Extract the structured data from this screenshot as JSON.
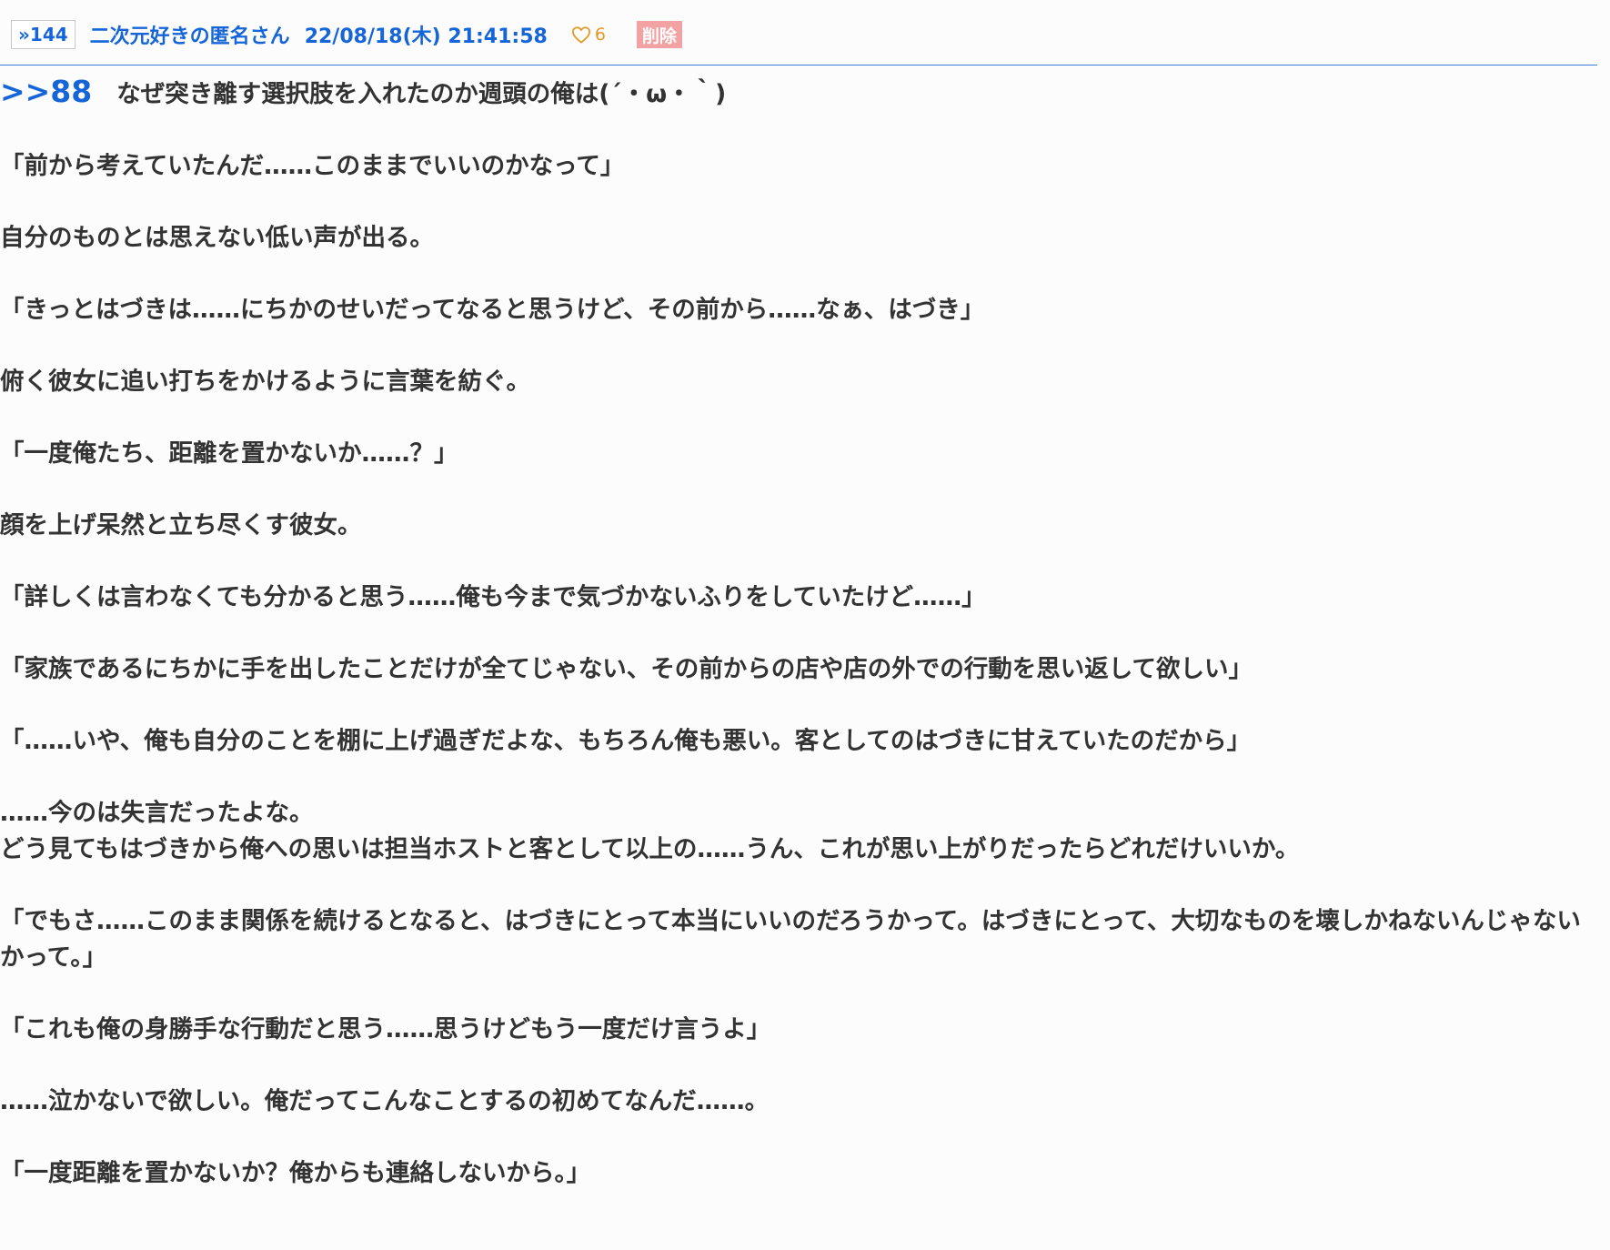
{
  "post": {
    "res_number": "»144",
    "poster_name": "二次元好きの匿名さん",
    "date": "22/08/18(木) 21:41:58",
    "likes": "6",
    "delete_label": "削除",
    "reply_link": ">>88",
    "reply_text": "なぜ突き離す選択肢を入れたのか週頭の俺は(´・ω・｀)",
    "paragraphs": [
      "「前から考えていたんだ……このままでいいのかなって」",
      "自分のものとは思えない低い声が出る。",
      "「きっとはづきは……にちかのせいだってなると思うけど、その前から……なぁ、はづき」",
      "俯く彼女に追い打ちをかけるように言葉を紡ぐ。",
      "「一度俺たち、距離を置かないか……？」",
      "顔を上げ呆然と立ち尽くす彼女。",
      "「詳しくは言わなくても分かると思う……俺も今まで気づかないふりをしていたけど……」",
      "「家族であるにちかに手を出したことだけが全てじゃない、その前からの店や店の外での行動を思い返して欲しい」",
      "「……いや、俺も自分のことを棚に上げ過ぎだよな、もちろん俺も悪い。客としてのはづきに甘えていたのだから」",
      "……今のは失言だったよな。",
      "どう見てもはづきから俺への思いは担当ホストと客として以上の……うん、これが思い上がりだったらどれだけいいか。",
      "「でもさ……このまま関係を続けるとなると、はづきにとって本当にいいのだろうかって。はづきにとって、大切なものを壊しかねないんじゃないかって。」",
      "「これも俺の身勝手な行動だと思う……思うけどもう一度だけ言うよ」",
      "……泣かないで欲しい。俺だってこんなことするの初めてなんだ……。",
      "「一度距離を置かないか？俺からも連絡しないから。」"
    ]
  },
  "icons": {
    "like": "heart-outline-icon"
  },
  "colors": {
    "link": "#1565d8",
    "like": "#e69a26",
    "delete_bg": "#f2a2a2",
    "rule": "#3c7bdb",
    "text": "#333333"
  }
}
